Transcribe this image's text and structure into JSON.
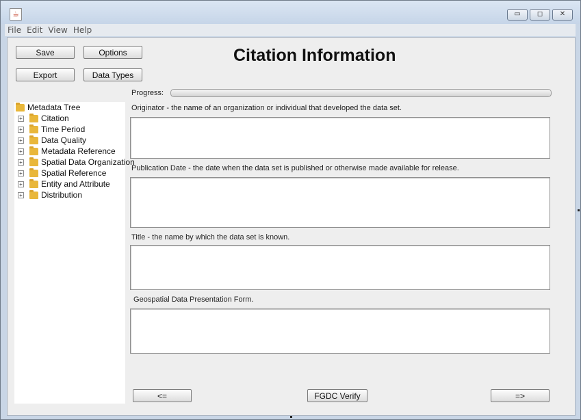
{
  "menu": [
    "File",
    "Edit",
    "View",
    "Help"
  ],
  "window_controls": {
    "minimize": "▭",
    "maximize": "◻",
    "close": "✕"
  },
  "toolbar": {
    "save": "Save",
    "options": "Options",
    "export": "Export",
    "data_types": "Data Types"
  },
  "title": "Citation Information",
  "progress": {
    "label": "Progress:",
    "value": 0
  },
  "tree": {
    "root": "Metadata Tree",
    "items": [
      "Citation",
      "Time Period",
      "Data Quality",
      "Metadata Reference",
      "Spatial Data Organization",
      "Spatial Reference",
      "Entity and Attribute",
      "Distribution"
    ]
  },
  "fields": [
    {
      "label": "Originator - the name of an organization or individual that developed the data set.",
      "value": ""
    },
    {
      "label": "Publication Date - the date when the data set is published or otherwise made available for release.",
      "value": ""
    },
    {
      "label": "Title - the name by which the data set is known.",
      "value": ""
    },
    {
      "label": " Geospatial Data Presentation Form.",
      "value": ""
    }
  ],
  "nav": {
    "back": "<=",
    "verify": "FGDC Verify",
    "forward": "=>"
  }
}
